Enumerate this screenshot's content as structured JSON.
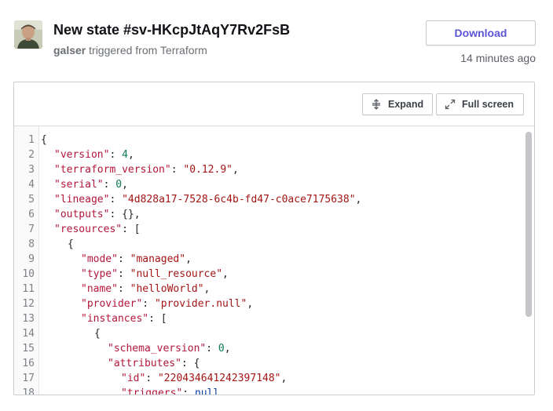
{
  "header": {
    "title": "New state #sv-HKcpJtAqY7Rv2FsB",
    "user": "galser",
    "trigger_text": "triggered from Terraform",
    "download_label": "Download",
    "timestamp": "14 minutes ago"
  },
  "toolbar": {
    "expand_label": "Expand",
    "fullscreen_label": "Full screen"
  },
  "code": {
    "lines": [
      {
        "no": "1",
        "indent": 0,
        "tokens": [
          {
            "t": "p",
            "v": "{"
          }
        ]
      },
      {
        "no": "2",
        "indent": 1,
        "tokens": [
          {
            "t": "k",
            "v": "\"version\""
          },
          {
            "t": "p",
            "v": ": "
          },
          {
            "t": "n",
            "v": "4"
          },
          {
            "t": "p",
            "v": ","
          }
        ]
      },
      {
        "no": "3",
        "indent": 1,
        "tokens": [
          {
            "t": "k",
            "v": "\"terraform_version\""
          },
          {
            "t": "p",
            "v": ": "
          },
          {
            "t": "s",
            "v": "\"0.12.9\""
          },
          {
            "t": "p",
            "v": ","
          }
        ]
      },
      {
        "no": "4",
        "indent": 1,
        "tokens": [
          {
            "t": "k",
            "v": "\"serial\""
          },
          {
            "t": "p",
            "v": ": "
          },
          {
            "t": "n",
            "v": "0"
          },
          {
            "t": "p",
            "v": ","
          }
        ]
      },
      {
        "no": "5",
        "indent": 1,
        "tokens": [
          {
            "t": "k",
            "v": "\"lineage\""
          },
          {
            "t": "p",
            "v": ": "
          },
          {
            "t": "s",
            "v": "\"4d828a17-7528-6c4b-fd47-c0ace7175638\""
          },
          {
            "t": "p",
            "v": ","
          }
        ]
      },
      {
        "no": "6",
        "indent": 1,
        "tokens": [
          {
            "t": "k",
            "v": "\"outputs\""
          },
          {
            "t": "p",
            "v": ": {},"
          }
        ]
      },
      {
        "no": "7",
        "indent": 1,
        "tokens": [
          {
            "t": "k",
            "v": "\"resources\""
          },
          {
            "t": "p",
            "v": ": ["
          }
        ]
      },
      {
        "no": "8",
        "indent": 2,
        "tokens": [
          {
            "t": "p",
            "v": "{"
          }
        ]
      },
      {
        "no": "9",
        "indent": 3,
        "tokens": [
          {
            "t": "k",
            "v": "\"mode\""
          },
          {
            "t": "p",
            "v": ": "
          },
          {
            "t": "s",
            "v": "\"managed\""
          },
          {
            "t": "p",
            "v": ","
          }
        ]
      },
      {
        "no": "10",
        "indent": 3,
        "tokens": [
          {
            "t": "k",
            "v": "\"type\""
          },
          {
            "t": "p",
            "v": ": "
          },
          {
            "t": "s",
            "v": "\"null_resource\""
          },
          {
            "t": "p",
            "v": ","
          }
        ]
      },
      {
        "no": "11",
        "indent": 3,
        "tokens": [
          {
            "t": "k",
            "v": "\"name\""
          },
          {
            "t": "p",
            "v": ": "
          },
          {
            "t": "s",
            "v": "\"helloWorld\""
          },
          {
            "t": "p",
            "v": ","
          }
        ]
      },
      {
        "no": "12",
        "indent": 3,
        "tokens": [
          {
            "t": "k",
            "v": "\"provider\""
          },
          {
            "t": "p",
            "v": ": "
          },
          {
            "t": "s",
            "v": "\"provider.null\""
          },
          {
            "t": "p",
            "v": ","
          }
        ]
      },
      {
        "no": "13",
        "indent": 3,
        "tokens": [
          {
            "t": "k",
            "v": "\"instances\""
          },
          {
            "t": "p",
            "v": ": ["
          }
        ]
      },
      {
        "no": "14",
        "indent": 4,
        "tokens": [
          {
            "t": "p",
            "v": "{"
          }
        ]
      },
      {
        "no": "15",
        "indent": 5,
        "tokens": [
          {
            "t": "k",
            "v": "\"schema_version\""
          },
          {
            "t": "p",
            "v": ": "
          },
          {
            "t": "n",
            "v": "0"
          },
          {
            "t": "p",
            "v": ","
          }
        ]
      },
      {
        "no": "16",
        "indent": 5,
        "tokens": [
          {
            "t": "k",
            "v": "\"attributes\""
          },
          {
            "t": "p",
            "v": ": {"
          }
        ]
      },
      {
        "no": "17",
        "indent": 6,
        "tokens": [
          {
            "t": "k",
            "v": "\"id\""
          },
          {
            "t": "p",
            "v": ": "
          },
          {
            "t": "s",
            "v": "\"220434641242397148\""
          },
          {
            "t": "p",
            "v": ","
          }
        ]
      },
      {
        "no": "18",
        "indent": 6,
        "tokens": [
          {
            "t": "k",
            "v": "\"triggers\""
          },
          {
            "t": "p",
            "v": ": "
          },
          {
            "t": "kw",
            "v": "null"
          }
        ]
      }
    ]
  },
  "colors": {
    "accent": "#5a56d6",
    "key": "#b3163a",
    "string": "#a31515",
    "number": "#0c7a52",
    "null": "#0b3ea1"
  },
  "icons": {
    "expand": "expand-arrows-icon",
    "fullscreen": "fullscreen-arrows-icon"
  }
}
